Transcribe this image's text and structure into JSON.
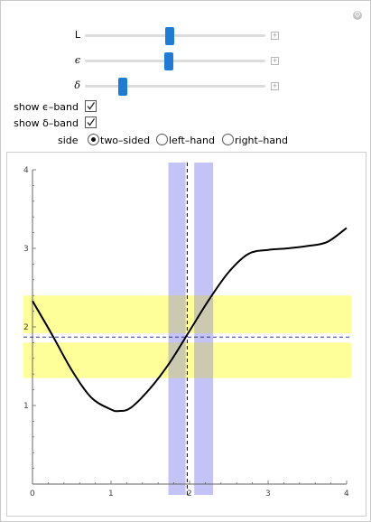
{
  "controls": {
    "sliders": [
      {
        "label": "L",
        "italic": false,
        "value_fraction": 0.47
      },
      {
        "label": "ϵ",
        "italic": true,
        "value_fraction": 0.465
      },
      {
        "label": "δ",
        "italic": true,
        "value_fraction": 0.21
      }
    ],
    "show_epsilon_band": {
      "label": "show ϵ–band",
      "checked": true
    },
    "show_delta_band": {
      "label": "show δ–band",
      "checked": true
    },
    "side": {
      "label": "side",
      "options": [
        "two–sided",
        "left–hand",
        "right–hand"
      ],
      "selected": "two–sided"
    }
  },
  "chart_data": {
    "type": "line",
    "xlim": [
      0,
      4
    ],
    "ylim": [
      0,
      4
    ],
    "x_ticks": [
      "0",
      "1",
      "2",
      "3",
      "4"
    ],
    "y_ticks": [
      "1",
      "2",
      "3",
      "4"
    ],
    "x_axis_origin_label": "0",
    "a": 1.97,
    "L": 1.87,
    "epsilon_band": [
      1.35,
      2.4
    ],
    "epsilon_gap": [
      1.8,
      1.92
    ],
    "delta_band": [
      1.73,
      2.3
    ],
    "delta_gap": [
      1.95,
      2.06
    ],
    "curve": {
      "x": [
        0,
        0.25,
        0.5,
        0.75,
        1.0,
        1.1,
        1.25,
        1.5,
        1.75,
        2.0,
        2.25,
        2.5,
        2.75,
        3.0,
        3.25,
        3.5,
        3.75,
        4.0
      ],
      "y": [
        2.33,
        1.9,
        1.45,
        1.1,
        0.95,
        0.93,
        0.97,
        1.22,
        1.55,
        1.95,
        2.35,
        2.7,
        2.93,
        2.98,
        3.0,
        3.03,
        3.08,
        3.26
      ]
    },
    "colors": {
      "epsilon_band": "#ffff99",
      "delta_band": "#b8b8f5",
      "overlap": "#cbcab0",
      "curve": "#000000",
      "guides": "#333399",
      "accent": "#1e7cd6"
    }
  }
}
